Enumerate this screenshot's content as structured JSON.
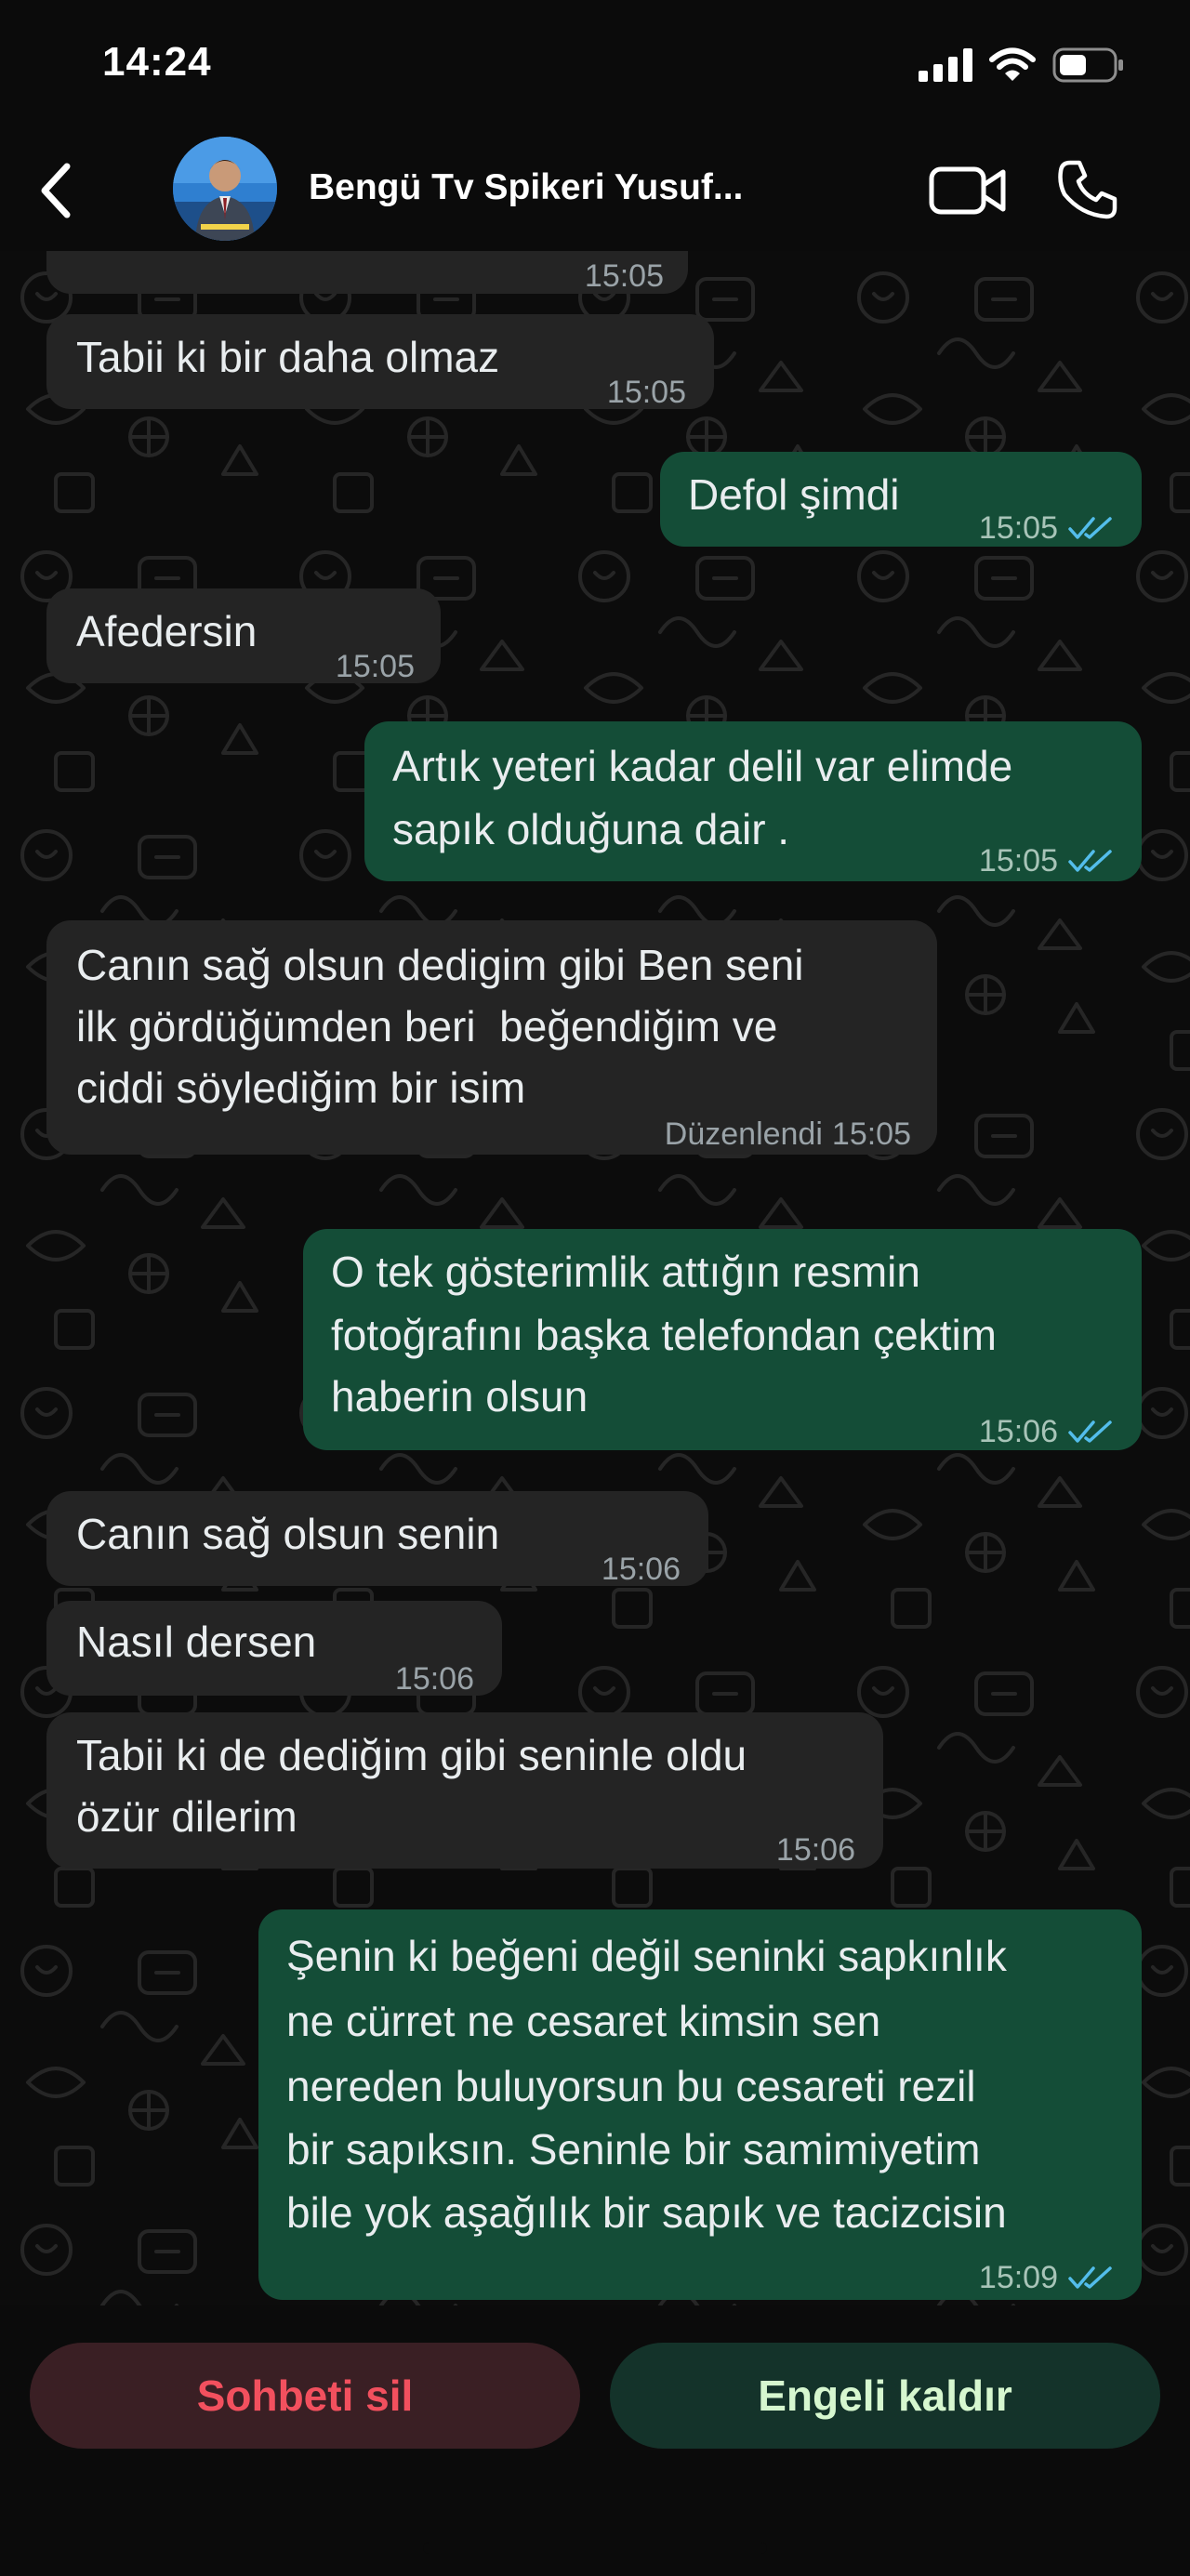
{
  "status_bar": {
    "time": "14:24"
  },
  "header": {
    "contact_name": "Bengü Tv Spikeri Yusuf..."
  },
  "messages": [
    {
      "dir": "in",
      "lines": [
        "Tabii ki bir daha olmaz"
      ],
      "time": "15:05"
    },
    {
      "dir": "out",
      "lines": [
        "Defol şimdi"
      ],
      "time": "15:05"
    },
    {
      "dir": "in",
      "lines": [
        "Afedersin"
      ],
      "time": "15:05"
    },
    {
      "dir": "out",
      "lines": [
        "Artık yeteri kadar delil var elimde",
        "sapık olduğuna dair ."
      ],
      "time": "15:05"
    },
    {
      "dir": "in",
      "lines": [
        "Canın sağ olsun dedigim gibi Ben seni",
        "ilk gördüğümden beri  beğendiğim ve",
        "ciddi söylediğim bir isim"
      ],
      "time": "15:05",
      "edited_label": "Düzenlendi"
    },
    {
      "dir": "out",
      "lines": [
        "O tek gösterimlik attığın resmin",
        "fotoğrafını başka telefondan çektim",
        "haberin olsun"
      ],
      "time": "15:06"
    },
    {
      "dir": "in",
      "lines": [
        "Canın sağ olsun senin"
      ],
      "time": "15:06"
    },
    {
      "dir": "in",
      "lines": [
        "Nasıl dersen"
      ],
      "time": "15:06"
    },
    {
      "dir": "in",
      "lines": [
        "Tabii ki de dediğim gibi seninle oldu",
        "özür dilerim"
      ],
      "time": "15:06"
    },
    {
      "dir": "out",
      "lines": [
        "Şenin ki beğeni değil seninki sapkınlık",
        "ne cürret ne cesaret kimsin sen",
        "nereden buluyorsun bu cesareti rezil",
        "bir sapıksın. Seninle bir samimiyetim",
        "bile yok aşağılık bir sapık ve tacizcisin"
      ],
      "time": "15:09"
    }
  ],
  "partial_top_message_time": "15:05",
  "actions": {
    "delete_label": "Sohbeti sil",
    "unblock_label": "Engeli kaldır"
  },
  "colors": {
    "incoming_bubble": "#242424",
    "outgoing_bubble": "#144d37",
    "read_ticks": "#53bdeb",
    "delete_text": "#f2505e",
    "unblock_text": "#d6f7cf"
  },
  "icons": {
    "back": "chevron-left-icon",
    "video": "video-camera-icon",
    "call": "phone-icon",
    "signal": "signal-icon",
    "wifi": "wifi-icon",
    "battery": "battery-icon",
    "read": "double-check-icon"
  }
}
